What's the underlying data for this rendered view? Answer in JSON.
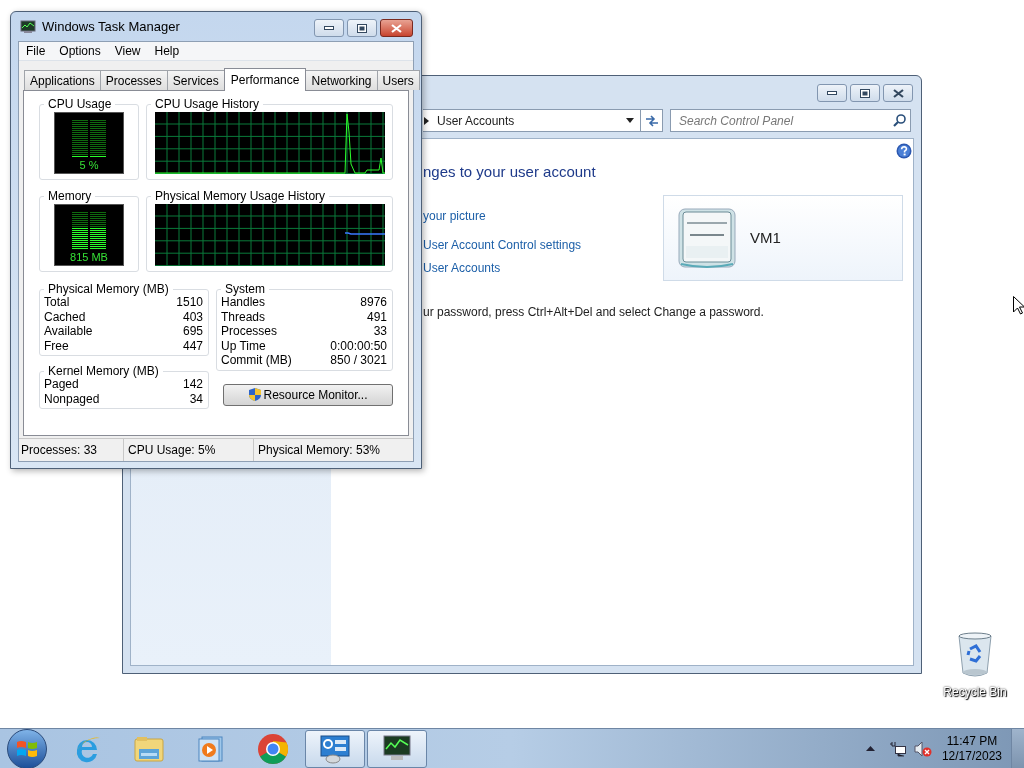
{
  "control_panel": {
    "breadcrumb": "User Accounts",
    "search": {
      "placeholder": "Search Control Panel"
    },
    "heading": "nges to your user account",
    "links": [
      "your picture",
      "User Account Control settings",
      "User Accounts"
    ],
    "account": {
      "name": "VM1"
    },
    "note": "ur password, press Ctrl+Alt+Del and select Change a password."
  },
  "task_manager": {
    "title": "Windows Task Manager",
    "menu": [
      "File",
      "Options",
      "View",
      "Help"
    ],
    "tabs": [
      {
        "label": "Applications",
        "selected": false
      },
      {
        "label": "Processes",
        "selected": false
      },
      {
        "label": "Services",
        "selected": false
      },
      {
        "label": "Performance",
        "selected": true
      },
      {
        "label": "Networking",
        "selected": false
      },
      {
        "label": "Users",
        "selected": false
      }
    ],
    "cpu": {
      "label": "CPU Usage",
      "reading": "5 %",
      "level": 0.05
    },
    "cpu_history": {
      "label": "CPU Usage History"
    },
    "memory": {
      "label": "Memory",
      "reading": "815 MB",
      "level": 0.54
    },
    "memory_history": {
      "label": "Physical Memory Usage History"
    },
    "physical_memory": {
      "title": "Physical Memory (MB)",
      "rows": [
        {
          "label": "Total",
          "value": "1510"
        },
        {
          "label": "Cached",
          "value": "403"
        },
        {
          "label": "Available",
          "value": "695"
        },
        {
          "label": "Free",
          "value": "447"
        }
      ]
    },
    "kernel_memory": {
      "title": "Kernel Memory (MB)",
      "rows": [
        {
          "label": "Paged",
          "value": "142"
        },
        {
          "label": "Nonpaged",
          "value": "34"
        }
      ]
    },
    "system": {
      "title": "System",
      "rows": [
        {
          "label": "Handles",
          "value": "8976"
        },
        {
          "label": "Threads",
          "value": "491"
        },
        {
          "label": "Processes",
          "value": "33"
        },
        {
          "label": "Up Time",
          "value": "0:00:00:50"
        },
        {
          "label": "Commit (MB)",
          "value": "850 / 3021"
        }
      ]
    },
    "resource_monitor_button": "Resource Monitor...",
    "status_bar": [
      "Processes: 33",
      "CPU Usage: 5%",
      "Physical Memory: 53%"
    ]
  },
  "desktop_icons": [
    {
      "label": "Recycle Bin"
    }
  ],
  "taskbar": {
    "apps": [
      {
        "kind": "ie",
        "running": false
      },
      {
        "kind": "explorer",
        "running": false
      },
      {
        "kind": "media",
        "running": false
      },
      {
        "kind": "chrome",
        "running": false
      },
      {
        "kind": "control_panel",
        "running": true
      },
      {
        "kind": "task_manager",
        "running": true
      }
    ],
    "clock": {
      "time": "11:47 PM",
      "date": "12/17/2023"
    }
  }
}
